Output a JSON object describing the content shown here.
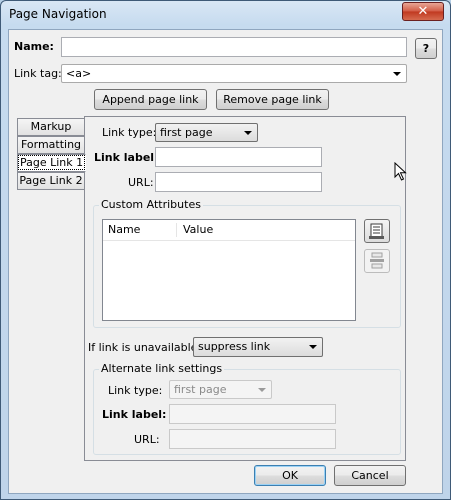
{
  "window": {
    "title": "Page Navigation",
    "close_symbol": "✕"
  },
  "header": {
    "name_label": "Name:",
    "name_value": "",
    "help_label": "?",
    "link_tag_label": "Link tag:",
    "link_tag_value": "<a>"
  },
  "actions": {
    "append_label": "Append page link",
    "remove_label": "Remove page link"
  },
  "tabs": [
    {
      "label": "Markup"
    },
    {
      "label": "Formatting"
    },
    {
      "label": "Page Link 1"
    },
    {
      "label": "Page Link 2"
    }
  ],
  "link": {
    "type_label": "Link type:",
    "type_value": "first page",
    "label_label": "Link label:",
    "label_value": "",
    "url_label": "URL:",
    "url_value": ""
  },
  "custom_attributes": {
    "title": "Custom Attributes",
    "columns": [
      "Name",
      "Value"
    ],
    "rows": []
  },
  "unavailable": {
    "label": "If link is unavailable:",
    "value": "suppress link"
  },
  "alternate": {
    "title": "Alternate link settings",
    "type_label": "Link type:",
    "type_value": "first page",
    "label_label": "Link label:",
    "label_value": "",
    "url_label": "URL:",
    "url_value": ""
  },
  "footer": {
    "ok_label": "OK",
    "cancel_label": "Cancel"
  }
}
